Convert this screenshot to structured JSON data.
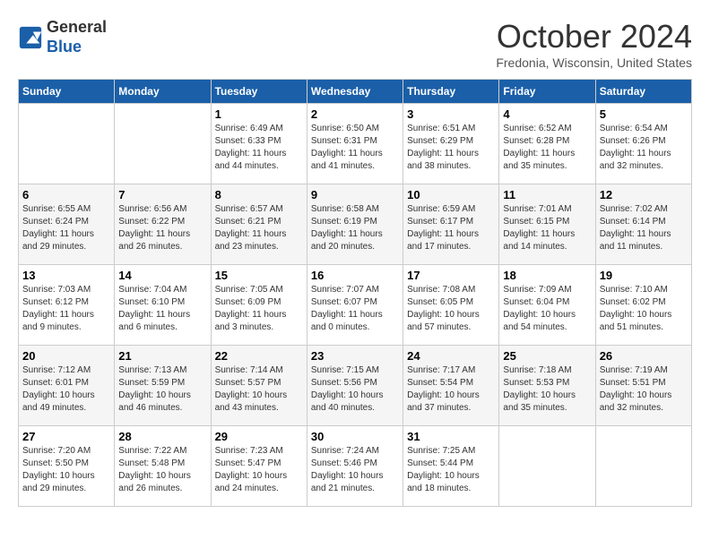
{
  "header": {
    "logo_line1": "General",
    "logo_line2": "Blue",
    "month": "October 2024",
    "location": "Fredonia, Wisconsin, United States"
  },
  "weekdays": [
    "Sunday",
    "Monday",
    "Tuesday",
    "Wednesday",
    "Thursday",
    "Friday",
    "Saturday"
  ],
  "weeks": [
    [
      {
        "day": "",
        "sunrise": "",
        "sunset": "",
        "daylight": ""
      },
      {
        "day": "",
        "sunrise": "",
        "sunset": "",
        "daylight": ""
      },
      {
        "day": "1",
        "sunrise": "Sunrise: 6:49 AM",
        "sunset": "Sunset: 6:33 PM",
        "daylight": "Daylight: 11 hours and 44 minutes."
      },
      {
        "day": "2",
        "sunrise": "Sunrise: 6:50 AM",
        "sunset": "Sunset: 6:31 PM",
        "daylight": "Daylight: 11 hours and 41 minutes."
      },
      {
        "day": "3",
        "sunrise": "Sunrise: 6:51 AM",
        "sunset": "Sunset: 6:29 PM",
        "daylight": "Daylight: 11 hours and 38 minutes."
      },
      {
        "day": "4",
        "sunrise": "Sunrise: 6:52 AM",
        "sunset": "Sunset: 6:28 PM",
        "daylight": "Daylight: 11 hours and 35 minutes."
      },
      {
        "day": "5",
        "sunrise": "Sunrise: 6:54 AM",
        "sunset": "Sunset: 6:26 PM",
        "daylight": "Daylight: 11 hours and 32 minutes."
      }
    ],
    [
      {
        "day": "6",
        "sunrise": "Sunrise: 6:55 AM",
        "sunset": "Sunset: 6:24 PM",
        "daylight": "Daylight: 11 hours and 29 minutes."
      },
      {
        "day": "7",
        "sunrise": "Sunrise: 6:56 AM",
        "sunset": "Sunset: 6:22 PM",
        "daylight": "Daylight: 11 hours and 26 minutes."
      },
      {
        "day": "8",
        "sunrise": "Sunrise: 6:57 AM",
        "sunset": "Sunset: 6:21 PM",
        "daylight": "Daylight: 11 hours and 23 minutes."
      },
      {
        "day": "9",
        "sunrise": "Sunrise: 6:58 AM",
        "sunset": "Sunset: 6:19 PM",
        "daylight": "Daylight: 11 hours and 20 minutes."
      },
      {
        "day": "10",
        "sunrise": "Sunrise: 6:59 AM",
        "sunset": "Sunset: 6:17 PM",
        "daylight": "Daylight: 11 hours and 17 minutes."
      },
      {
        "day": "11",
        "sunrise": "Sunrise: 7:01 AM",
        "sunset": "Sunset: 6:15 PM",
        "daylight": "Daylight: 11 hours and 14 minutes."
      },
      {
        "day": "12",
        "sunrise": "Sunrise: 7:02 AM",
        "sunset": "Sunset: 6:14 PM",
        "daylight": "Daylight: 11 hours and 11 minutes."
      }
    ],
    [
      {
        "day": "13",
        "sunrise": "Sunrise: 7:03 AM",
        "sunset": "Sunset: 6:12 PM",
        "daylight": "Daylight: 11 hours and 9 minutes."
      },
      {
        "day": "14",
        "sunrise": "Sunrise: 7:04 AM",
        "sunset": "Sunset: 6:10 PM",
        "daylight": "Daylight: 11 hours and 6 minutes."
      },
      {
        "day": "15",
        "sunrise": "Sunrise: 7:05 AM",
        "sunset": "Sunset: 6:09 PM",
        "daylight": "Daylight: 11 hours and 3 minutes."
      },
      {
        "day": "16",
        "sunrise": "Sunrise: 7:07 AM",
        "sunset": "Sunset: 6:07 PM",
        "daylight": "Daylight: 11 hours and 0 minutes."
      },
      {
        "day": "17",
        "sunrise": "Sunrise: 7:08 AM",
        "sunset": "Sunset: 6:05 PM",
        "daylight": "Daylight: 10 hours and 57 minutes."
      },
      {
        "day": "18",
        "sunrise": "Sunrise: 7:09 AM",
        "sunset": "Sunset: 6:04 PM",
        "daylight": "Daylight: 10 hours and 54 minutes."
      },
      {
        "day": "19",
        "sunrise": "Sunrise: 7:10 AM",
        "sunset": "Sunset: 6:02 PM",
        "daylight": "Daylight: 10 hours and 51 minutes."
      }
    ],
    [
      {
        "day": "20",
        "sunrise": "Sunrise: 7:12 AM",
        "sunset": "Sunset: 6:01 PM",
        "daylight": "Daylight: 10 hours and 49 minutes."
      },
      {
        "day": "21",
        "sunrise": "Sunrise: 7:13 AM",
        "sunset": "Sunset: 5:59 PM",
        "daylight": "Daylight: 10 hours and 46 minutes."
      },
      {
        "day": "22",
        "sunrise": "Sunrise: 7:14 AM",
        "sunset": "Sunset: 5:57 PM",
        "daylight": "Daylight: 10 hours and 43 minutes."
      },
      {
        "day": "23",
        "sunrise": "Sunrise: 7:15 AM",
        "sunset": "Sunset: 5:56 PM",
        "daylight": "Daylight: 10 hours and 40 minutes."
      },
      {
        "day": "24",
        "sunrise": "Sunrise: 7:17 AM",
        "sunset": "Sunset: 5:54 PM",
        "daylight": "Daylight: 10 hours and 37 minutes."
      },
      {
        "day": "25",
        "sunrise": "Sunrise: 7:18 AM",
        "sunset": "Sunset: 5:53 PM",
        "daylight": "Daylight: 10 hours and 35 minutes."
      },
      {
        "day": "26",
        "sunrise": "Sunrise: 7:19 AM",
        "sunset": "Sunset: 5:51 PM",
        "daylight": "Daylight: 10 hours and 32 minutes."
      }
    ],
    [
      {
        "day": "27",
        "sunrise": "Sunrise: 7:20 AM",
        "sunset": "Sunset: 5:50 PM",
        "daylight": "Daylight: 10 hours and 29 minutes."
      },
      {
        "day": "28",
        "sunrise": "Sunrise: 7:22 AM",
        "sunset": "Sunset: 5:48 PM",
        "daylight": "Daylight: 10 hours and 26 minutes."
      },
      {
        "day": "29",
        "sunrise": "Sunrise: 7:23 AM",
        "sunset": "Sunset: 5:47 PM",
        "daylight": "Daylight: 10 hours and 24 minutes."
      },
      {
        "day": "30",
        "sunrise": "Sunrise: 7:24 AM",
        "sunset": "Sunset: 5:46 PM",
        "daylight": "Daylight: 10 hours and 21 minutes."
      },
      {
        "day": "31",
        "sunrise": "Sunrise: 7:25 AM",
        "sunset": "Sunset: 5:44 PM",
        "daylight": "Daylight: 10 hours and 18 minutes."
      },
      {
        "day": "",
        "sunrise": "",
        "sunset": "",
        "daylight": ""
      },
      {
        "day": "",
        "sunrise": "",
        "sunset": "",
        "daylight": ""
      }
    ]
  ]
}
